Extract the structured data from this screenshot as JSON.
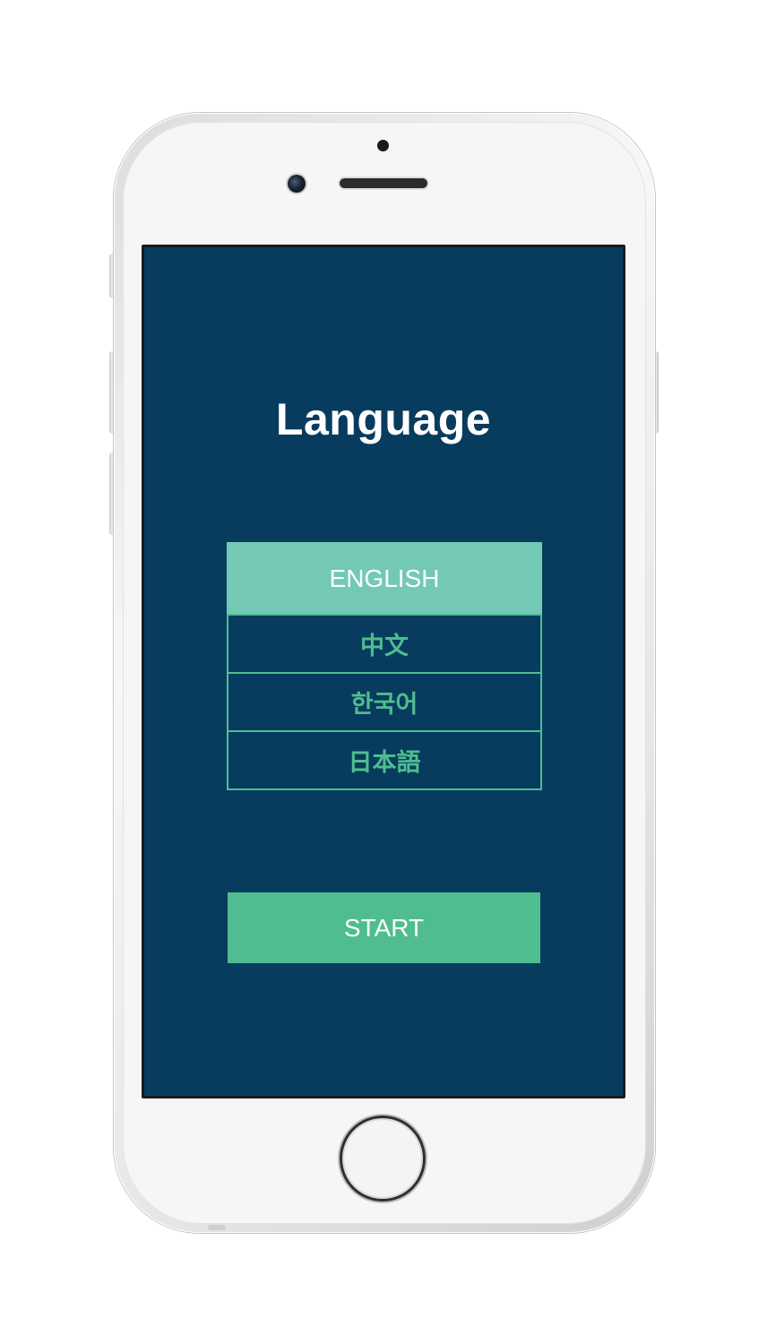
{
  "screen": {
    "title": "Language",
    "languages": [
      {
        "label": "ENGLISH",
        "selected": true
      },
      {
        "label": "中文",
        "selected": false
      },
      {
        "label": "한국어",
        "selected": false
      },
      {
        "label": "日本語",
        "selected": false
      }
    ],
    "start_label": "START"
  },
  "colors": {
    "background": "#073c5e",
    "accent": "#4fbd8f",
    "selected": "#73c9b5",
    "title_text": "#ffffff"
  },
  "icons": {
    "home_button": "home-button-icon",
    "front_camera": "front-camera-icon",
    "speaker": "speaker-grille-icon"
  }
}
